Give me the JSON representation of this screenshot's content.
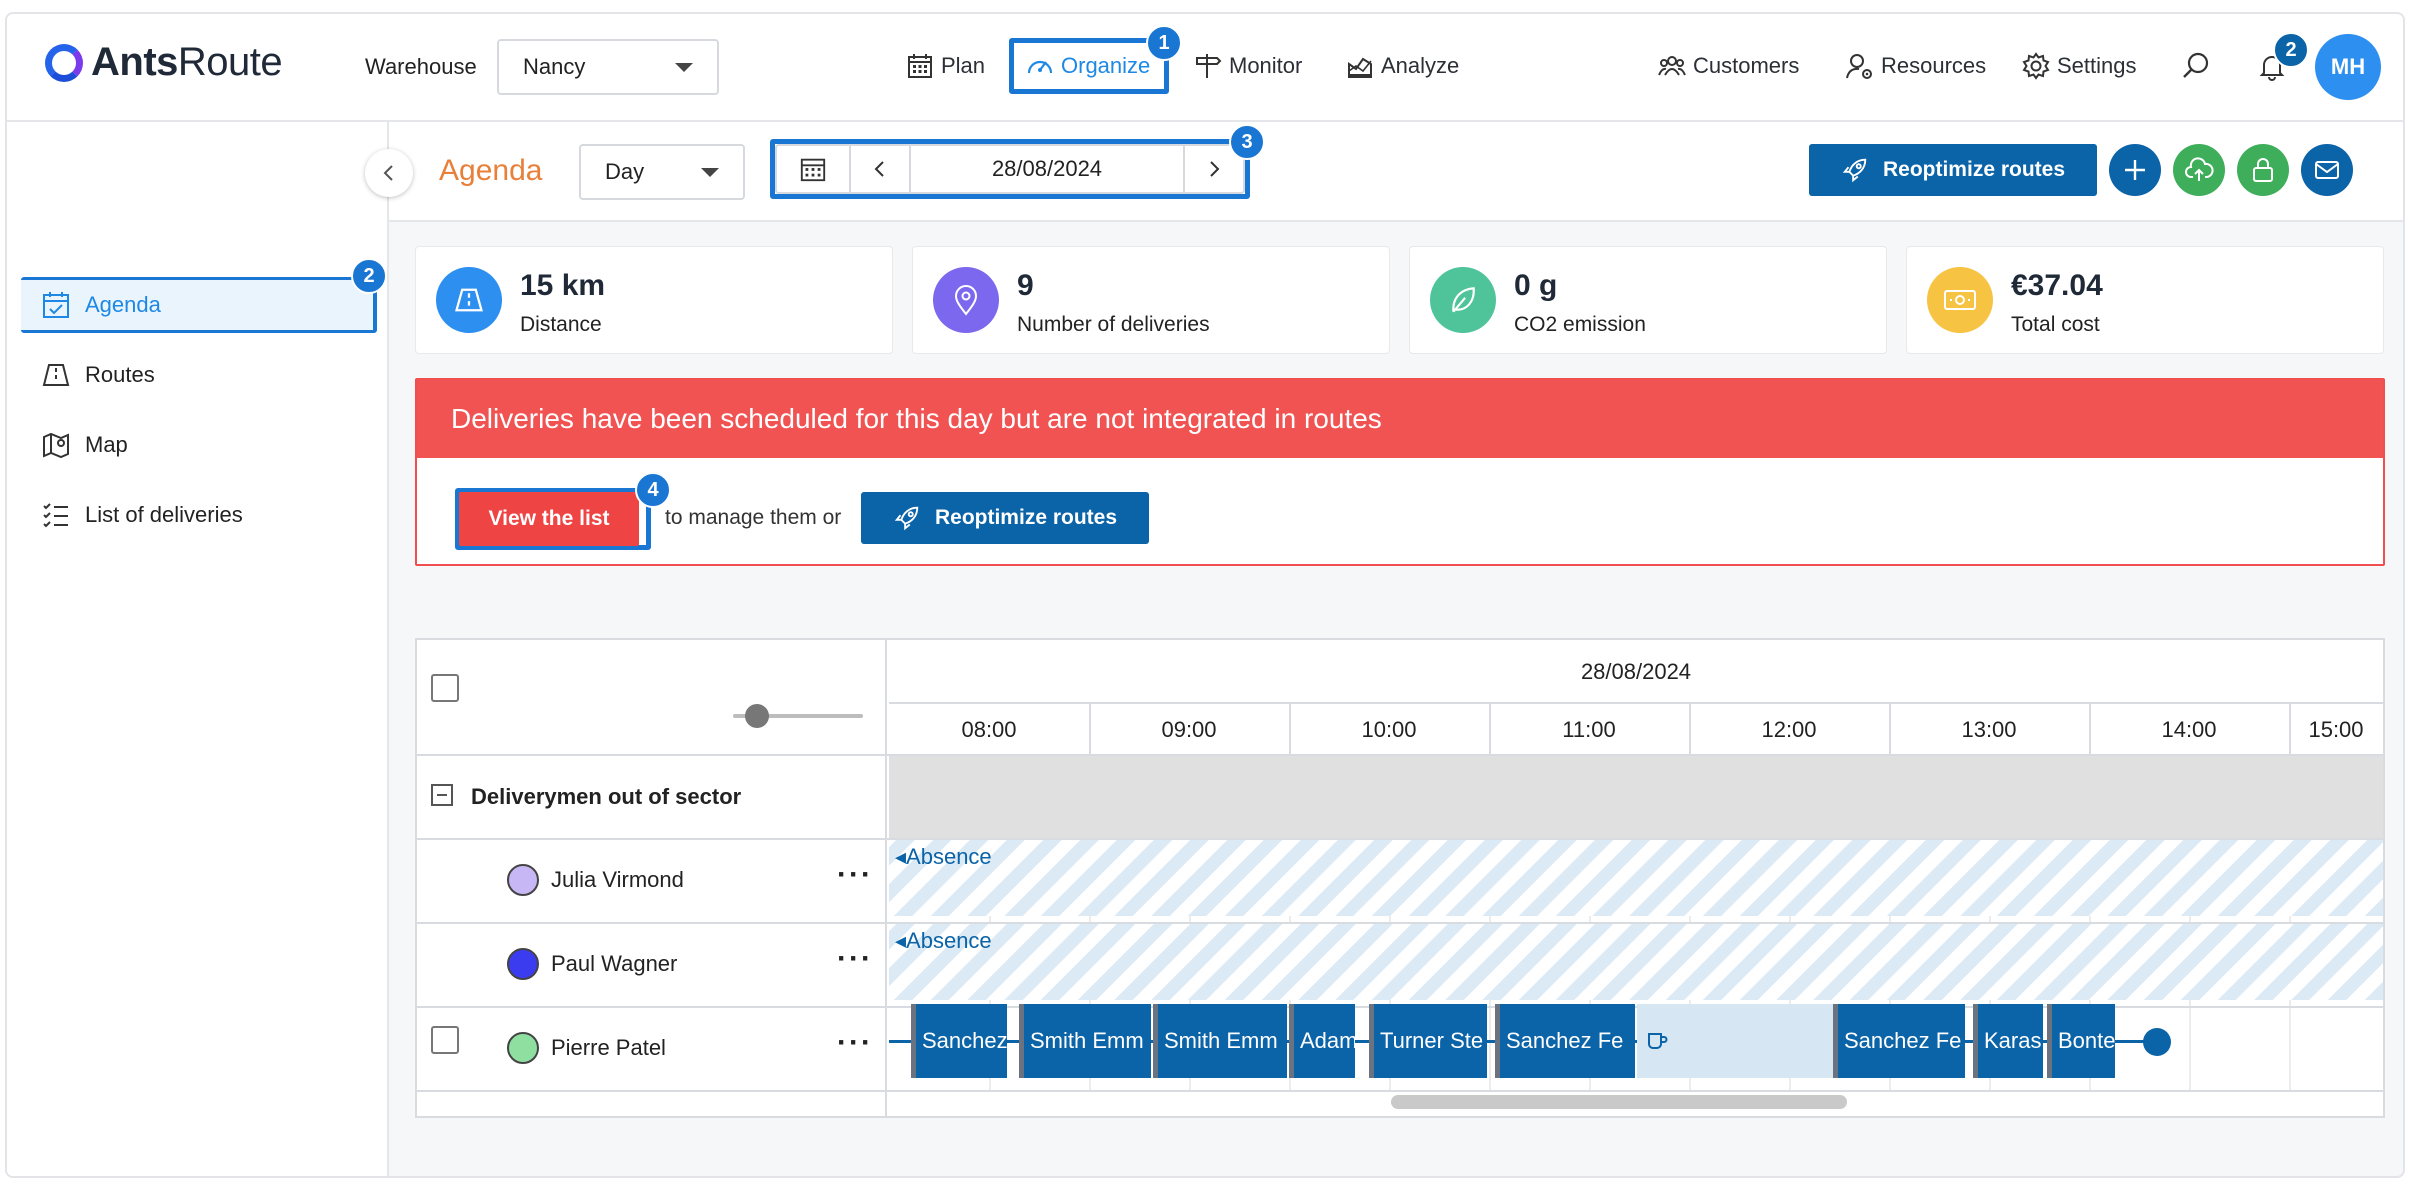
{
  "app": {
    "logo_bold": "Ants",
    "logo_light": "Route"
  },
  "topbar": {
    "warehouse_label": "Warehouse",
    "warehouse_value": "Nancy",
    "nav": {
      "plan": "Plan",
      "organize": "Organize",
      "monitor": "Monitor",
      "analyze": "Analyze"
    },
    "right": {
      "customers": "Customers",
      "resources": "Resources",
      "settings": "Settings"
    },
    "notifications_count": "2",
    "avatar_initials": "MH"
  },
  "annotations": {
    "b1": "1",
    "b2": "2",
    "b3": "3",
    "b4": "4"
  },
  "sidebar": {
    "items": [
      {
        "label": "Agenda",
        "icon": "calendar-check-icon"
      },
      {
        "label": "Routes",
        "icon": "road-icon"
      },
      {
        "label": "Map",
        "icon": "map-icon"
      },
      {
        "label": "List of deliveries",
        "icon": "checklist-icon"
      }
    ]
  },
  "subheader": {
    "title": "Agenda",
    "view_mode": "Day",
    "date": "28/08/2024",
    "reoptimize_label": "Reoptimize routes"
  },
  "stats": [
    {
      "value": "15 km",
      "label": "Distance",
      "color": "#2d8ff0"
    },
    {
      "value": "9",
      "label": "Number of deliveries",
      "color": "#7b68ee"
    },
    {
      "value": "0 g",
      "label": "CO2 emission",
      "color": "#4fc49b"
    },
    {
      "value": "€37.04",
      "label": "Total cost",
      "color": "#f6c342"
    }
  ],
  "alert": {
    "message": "Deliveries have been scheduled for this day but are not integrated in routes",
    "view_list": "View the list",
    "middle_text": "to manage them or",
    "reoptimize": "Reoptimize routes"
  },
  "scheduler": {
    "date": "28/08/2024",
    "hours": [
      "08:00",
      "09:00",
      "10:00",
      "11:00",
      "12:00",
      "13:00",
      "14:00",
      "15:00"
    ],
    "group": "Deliverymen out of sector",
    "absence_label": "Absence",
    "drivers": [
      {
        "name": "Julia Virmond",
        "color": "#c7b8f5"
      },
      {
        "name": "Paul Wagner",
        "color": "#3b3bf0"
      },
      {
        "name": "Pierre Patel",
        "color": "#8fe0a0"
      }
    ],
    "tasks": [
      "Sanchez",
      "Smith Emm",
      "Smith Emm",
      "Adam",
      "Turner Ste",
      "Sanchez Fe",
      "Sanchez Fe",
      "Karas",
      "Bonte"
    ]
  },
  "colors": {
    "accent": "#1e88e5",
    "primary_button": "#0b63a8",
    "alert": "#f15252",
    "agenda_title": "#e8803a"
  }
}
